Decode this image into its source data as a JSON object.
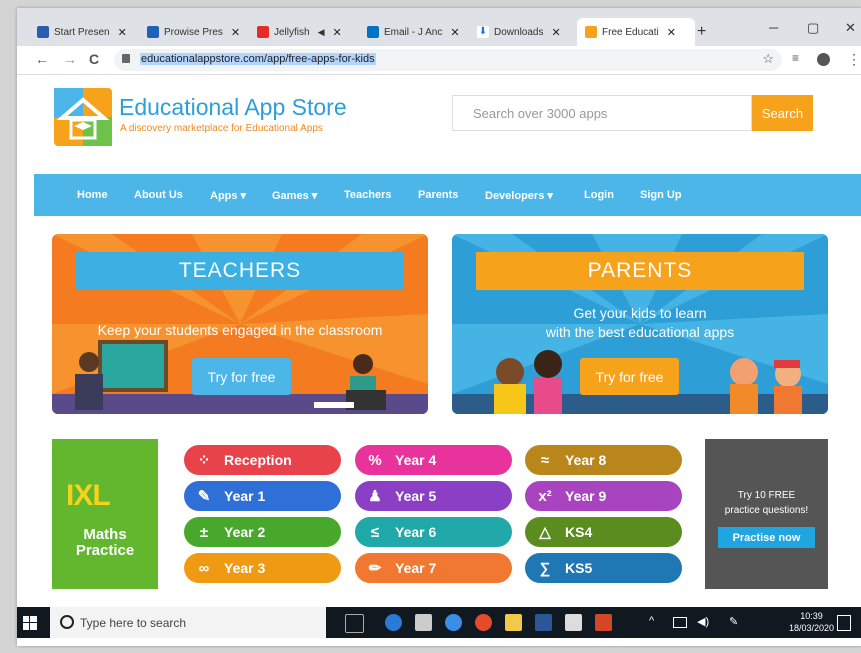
{
  "browser": {
    "tabs": [
      {
        "label": "Start Presen",
        "color": "#2a5db0"
      },
      {
        "label": "Prowise Pres",
        "color": "#1d62b6"
      },
      {
        "label": "Jellyfish",
        "color": "#e52d27"
      },
      {
        "label": "Email - J Anc",
        "color": "#0072c6"
      },
      {
        "label": "Downloads",
        "color": "#1a73e8"
      },
      {
        "label": "Free Educati",
        "color": "#f7a21b"
      }
    ],
    "new_tab": "+",
    "tab_close": "✕",
    "mute": "◀",
    "url": "educationalappstore.com/app/free-apps-for-kids",
    "win_min": "─",
    "win_max": "▢",
    "win_close": "✕",
    "back": "←",
    "forward": "→",
    "reload": "C",
    "star": "☆",
    "menu": "⋮"
  },
  "site": {
    "title": "Educational App Store",
    "tagline": "A discovery marketplace for Educational Apps",
    "search_placeholder": "Search over 3000 apps",
    "search_button": "Search",
    "nav": [
      "Home",
      "About Us",
      "Apps ▾",
      "Games ▾",
      "Teachers",
      "Parents",
      "Developers ▾",
      "Login",
      "Sign Up"
    ]
  },
  "banners": {
    "teachers": {
      "title": "TEACHERS",
      "text": "Keep your students engaged in the classroom",
      "button": "Try for free"
    },
    "parents": {
      "title": "PARENTS",
      "text_line1": "Get your kids to learn",
      "text_line2": "with the best educational apps",
      "button": "Try for free"
    }
  },
  "ixl": {
    "logo": "IXL",
    "line1": "Maths",
    "line2": "Practice",
    "years": [
      {
        "label": "Reception",
        "icon": "⁘",
        "color": "#e8424b"
      },
      {
        "label": "Year 1",
        "icon": "✎",
        "color": "#2e6fd8"
      },
      {
        "label": "Year 2",
        "icon": "±",
        "color": "#47a82b"
      },
      {
        "label": "Year 3",
        "icon": "∞",
        "color": "#f09a14"
      },
      {
        "label": "Year 4",
        "icon": "%",
        "color": "#e8339c"
      },
      {
        "label": "Year 5",
        "icon": "♟",
        "color": "#8a3fc4"
      },
      {
        "label": "Year 6",
        "icon": "≤",
        "color": "#21a8a8"
      },
      {
        "label": "Year 7",
        "icon": "✏",
        "color": "#f07830"
      },
      {
        "label": "Year 8",
        "icon": "≈",
        "color": "#b8861b"
      },
      {
        "label": "Year 9",
        "icon": "x²",
        "color": "#a844c0"
      },
      {
        "label": "KS4",
        "icon": "△",
        "color": "#5b8c1f"
      },
      {
        "label": "KS5",
        "icon": "∑",
        "color": "#1f78b4"
      }
    ],
    "promo_line1": "Try 10 FREE",
    "promo_line2": "practice questions!",
    "promo_button": "Practise now"
  },
  "taskbar": {
    "search_placeholder": "Type here to search",
    "time": "10:39",
    "date": "18/03/2020"
  }
}
